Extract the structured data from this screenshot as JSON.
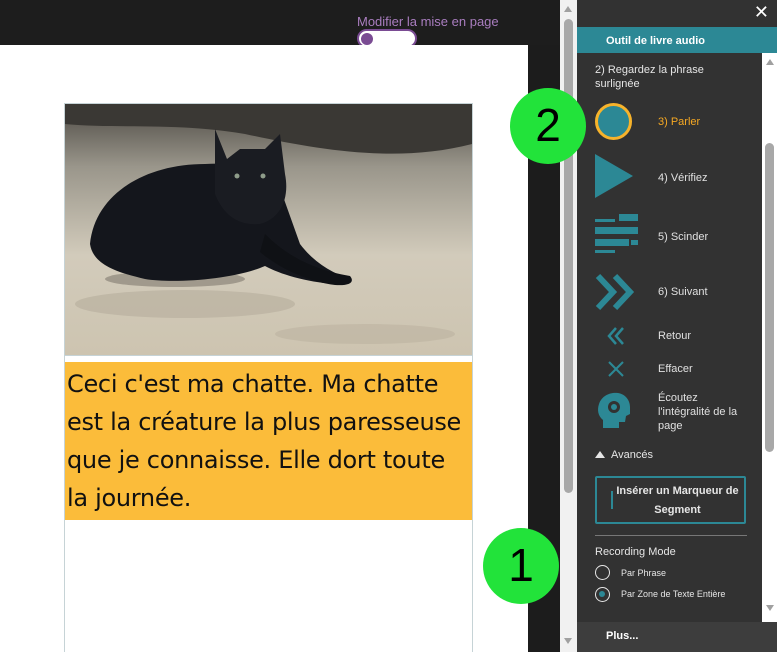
{
  "editor": {
    "layout_toggle_label": "Modifier la mise en page",
    "page_text": "Ceci c'est ma chatte. Ma chatte est la créature la plus paresseuse que je connaisse. Elle dort toute la journée."
  },
  "panel": {
    "close_label": "✕",
    "title": "Outil de livre audio",
    "instruction": "2) Regardez la phrase surlignée",
    "tools": {
      "speak": "3) Parler",
      "verify": "4) Vérifiez",
      "split": "5) Scinder",
      "next": "6) Suivant",
      "back": "Retour",
      "clear": "Effacer",
      "listen_all": "Écoutez l'intégralité de la page"
    },
    "advanced_label": "Avancés",
    "insert_marker_label": "Insérer un Marqueur de Segment",
    "recording_mode": {
      "title": "Recording Mode",
      "options": [
        "Par Phrase",
        "Par Zone de Texte Entière"
      ],
      "selected": "Par Zone de Texte Entière"
    },
    "footer_label": "Plus..."
  },
  "callouts": {
    "one": "1",
    "two": "2"
  },
  "colors": {
    "teal_accent": "#2c8895",
    "highlight": "#fbbc3a",
    "active_step": "#f5a823",
    "callout_green": "#22e33a",
    "toggle_purple": "#7a4b93"
  },
  "icons": {
    "speak": "circle-record-icon",
    "verify": "play-triangle-icon",
    "split": "split-bars-icon",
    "next": "double-chevron-right-icon",
    "back": "double-chevron-left-icon",
    "clear": "x-icon",
    "listen_all": "head-speaker-icon"
  }
}
